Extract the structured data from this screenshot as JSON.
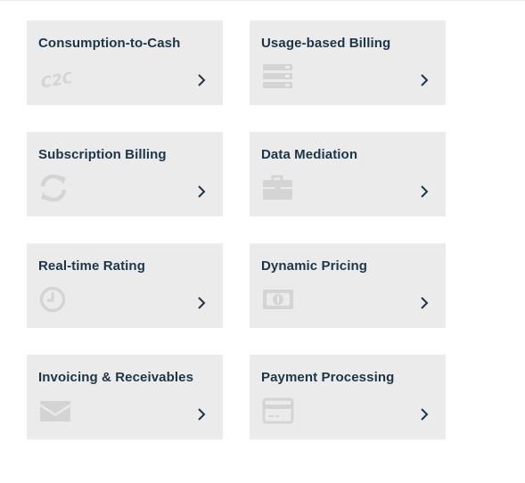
{
  "cards": [
    {
      "title": "Consumption-to-Cash",
      "icon": "c2c-logo-icon"
    },
    {
      "title": "Usage-based Billing",
      "icon": "server-stack-icon"
    },
    {
      "title": "Subscription Billing",
      "icon": "refresh-icon"
    },
    {
      "title": "Data Mediation",
      "icon": "briefcase-icon"
    },
    {
      "title": "Real-time Rating",
      "icon": "clock-icon"
    },
    {
      "title": "Dynamic Pricing",
      "icon": "money-bill-icon"
    },
    {
      "title": "Invoicing & Receivables",
      "icon": "envelope-icon"
    },
    {
      "title": "Payment Processing",
      "icon": "credit-card-icon"
    }
  ],
  "c2c_logo_text": "C2C",
  "colors": {
    "card_background": "#ebebeb",
    "title_text": "#1d3548",
    "icon_muted": "#d4d4d4",
    "chevron": "#1d3548"
  }
}
